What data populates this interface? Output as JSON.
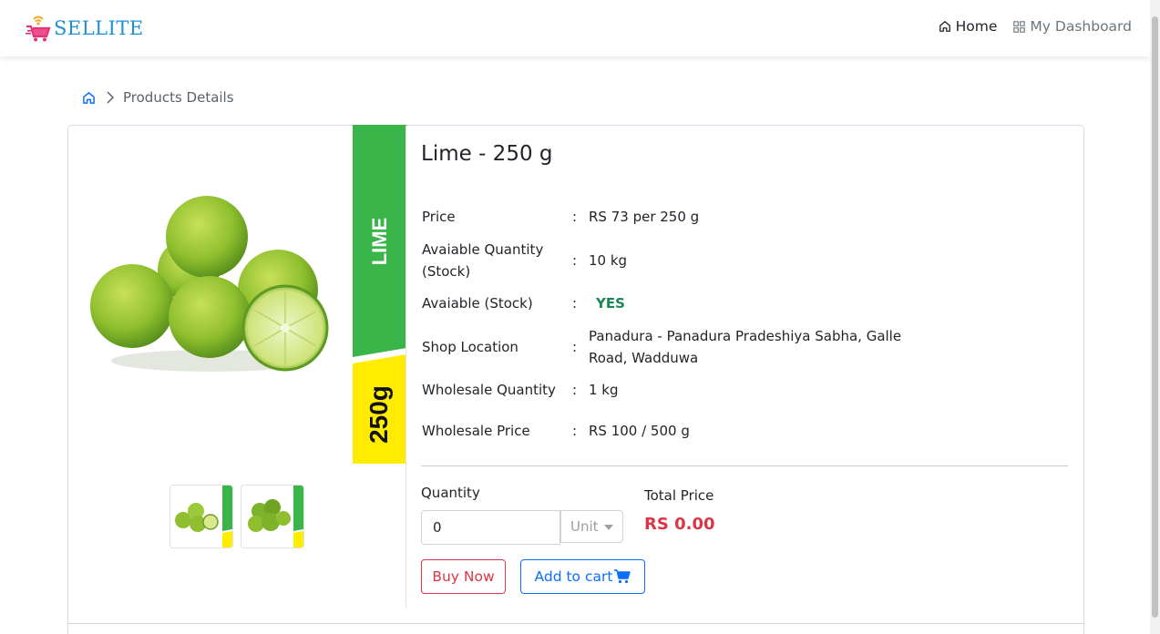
{
  "brand": {
    "name": "SELLITE"
  },
  "nav": {
    "home": "Home",
    "dashboard": "My Dashboard"
  },
  "breadcrumb": {
    "current": "Products Details"
  },
  "product": {
    "title": "Lime - 250 g",
    "banner_name": "LIME",
    "banner_weight": "250g",
    "specs": [
      {
        "label": "Price",
        "value": "RS 73 per 250 g"
      },
      {
        "label": "Avaiable Quantity (Stock)",
        "value": "10 kg"
      },
      {
        "label": "Avaiable (Stock)",
        "value": "YES"
      },
      {
        "label": "Shop Location",
        "value": "Panadura - Panadura Pradeshiya Sabha, Galle Road, Wadduwa"
      },
      {
        "label": "Wholesale Quantity",
        "value": "1 kg"
      },
      {
        "label": "Wholesale Price",
        "value": "RS 100 / 500 g"
      }
    ],
    "colon": ":"
  },
  "order": {
    "quantity_label": "Quantity",
    "quantity_value": "0",
    "unit_placeholder": "Unit",
    "total_label": "Total Price",
    "total_value": "RS 0.00",
    "buy_label": "Buy Now",
    "cart_label": "Add to cart"
  },
  "colors": {
    "brand": "#1e90d6",
    "banner_green": "#39b54a",
    "banner_yellow": "#ffec00",
    "yes": "#198754",
    "price": "#dc3545",
    "primary": "#0d6efd"
  }
}
